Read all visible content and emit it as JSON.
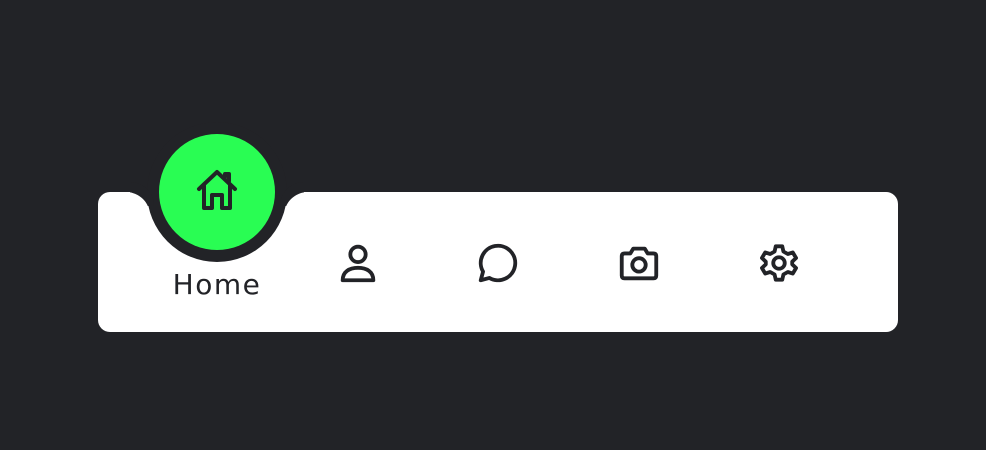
{
  "nav": {
    "active_index": 0,
    "colors": {
      "background": "#222327",
      "bar": "#ffffff",
      "accent": "#29fd53",
      "icon": "#222327"
    },
    "items": [
      {
        "id": "home",
        "label": "Home",
        "icon": "home-icon"
      },
      {
        "id": "profile",
        "label": "",
        "icon": "person-icon"
      },
      {
        "id": "messages",
        "label": "",
        "icon": "chat-bubble-icon"
      },
      {
        "id": "photos",
        "label": "",
        "icon": "camera-icon"
      },
      {
        "id": "settings",
        "label": "",
        "icon": "gear-icon"
      }
    ]
  }
}
